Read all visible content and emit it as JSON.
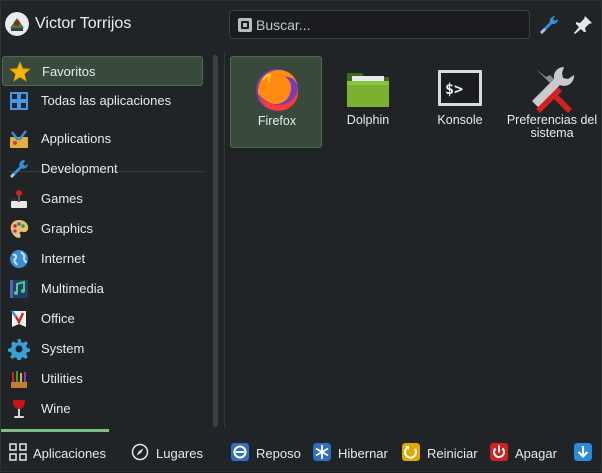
{
  "header": {
    "user_name": "Victor Torrijos",
    "search_placeholder": "Buscar..."
  },
  "sidebar": {
    "items": [
      {
        "label": "Favoritos",
        "icon": "star-icon",
        "active": true
      },
      {
        "label": "Todas las aplicaciones",
        "icon": "grid-icon"
      },
      {
        "label": "Applications",
        "icon": "applications-icon"
      },
      {
        "label": "Development",
        "icon": "wrench-icon"
      },
      {
        "label": "Games",
        "icon": "joystick-icon"
      },
      {
        "label": "Graphics",
        "icon": "palette-icon"
      },
      {
        "label": "Internet",
        "icon": "globe-icon"
      },
      {
        "label": "Multimedia",
        "icon": "music-icon"
      },
      {
        "label": "Office",
        "icon": "office-icon"
      },
      {
        "label": "System",
        "icon": "gear-icon"
      },
      {
        "label": "Utilities",
        "icon": "utilities-icon"
      },
      {
        "label": "Wine",
        "icon": "wine-glass-icon"
      }
    ]
  },
  "favorites": [
    {
      "label": "Firefox",
      "icon": "firefox-icon",
      "active": true
    },
    {
      "label": "Dolphin",
      "icon": "folder-icon"
    },
    {
      "label": "Konsole",
      "icon": "terminal-icon"
    },
    {
      "label": "Preferencias del sistema",
      "icon": "tools-icon"
    }
  ],
  "footer": {
    "tabs": [
      {
        "label": "Aplicaciones",
        "icon": "apps-grid-icon",
        "active": true
      },
      {
        "label": "Lugares",
        "icon": "compass-icon"
      }
    ],
    "power": [
      {
        "label": "Reposo",
        "icon": "sleep-icon",
        "color": "#2f6fc0"
      },
      {
        "label": "Hibernar",
        "icon": "snowflake-icon",
        "color": "#2f6fc0"
      },
      {
        "label": "Reiniciar",
        "icon": "restart-icon",
        "color": "#e0a800"
      },
      {
        "label": "Apagar",
        "icon": "power-icon",
        "color": "#d42020"
      }
    ],
    "more_icon": "arrow-down-icon"
  },
  "colors": {
    "accent": "#7fbf7f",
    "highlight_bg": "#394a3d",
    "background": "#212427"
  }
}
